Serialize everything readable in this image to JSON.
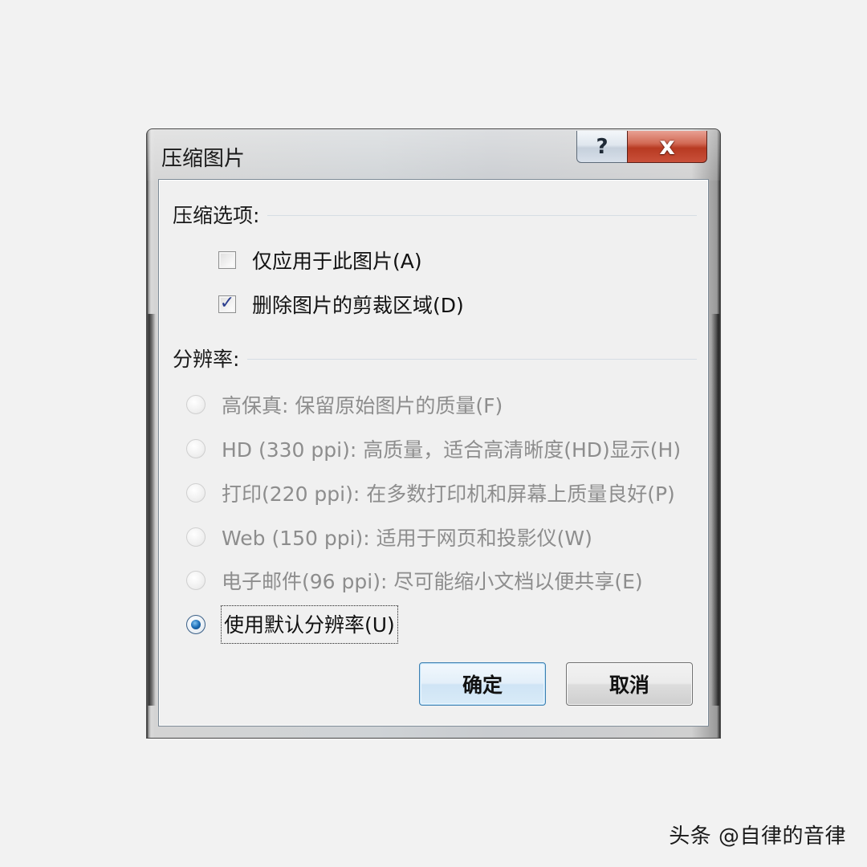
{
  "window": {
    "title": "压缩图片",
    "help_glyph": "?",
    "close_glyph": "x"
  },
  "compress_options": {
    "header": "压缩选项:",
    "items": [
      {
        "label": "仅应用于此图片(A)",
        "checked": false
      },
      {
        "label": "删除图片的剪裁区域(D)",
        "checked": true,
        "tick": "✓"
      }
    ]
  },
  "resolution": {
    "header": "分辨率:",
    "options": [
      {
        "label": "高保真: 保留原始图片的质量(F)",
        "enabled": false,
        "selected": false
      },
      {
        "label": "HD (330 ppi): 高质量，适合高清晰度(HD)显示(H)",
        "enabled": false,
        "selected": false
      },
      {
        "label": "打印(220 ppi): 在多数打印机和屏幕上质量良好(P)",
        "enabled": false,
        "selected": false
      },
      {
        "label": "Web (150 ppi): 适用于网页和投影仪(W)",
        "enabled": false,
        "selected": false
      },
      {
        "label": "电子邮件(96 ppi): 尽可能缩小文档以便共享(E)",
        "enabled": false,
        "selected": false
      },
      {
        "label": "使用默认分辨率(U)",
        "enabled": true,
        "selected": true
      }
    ]
  },
  "buttons": {
    "ok": "确定",
    "cancel": "取消"
  },
  "watermark": "头条 @自律的音律"
}
